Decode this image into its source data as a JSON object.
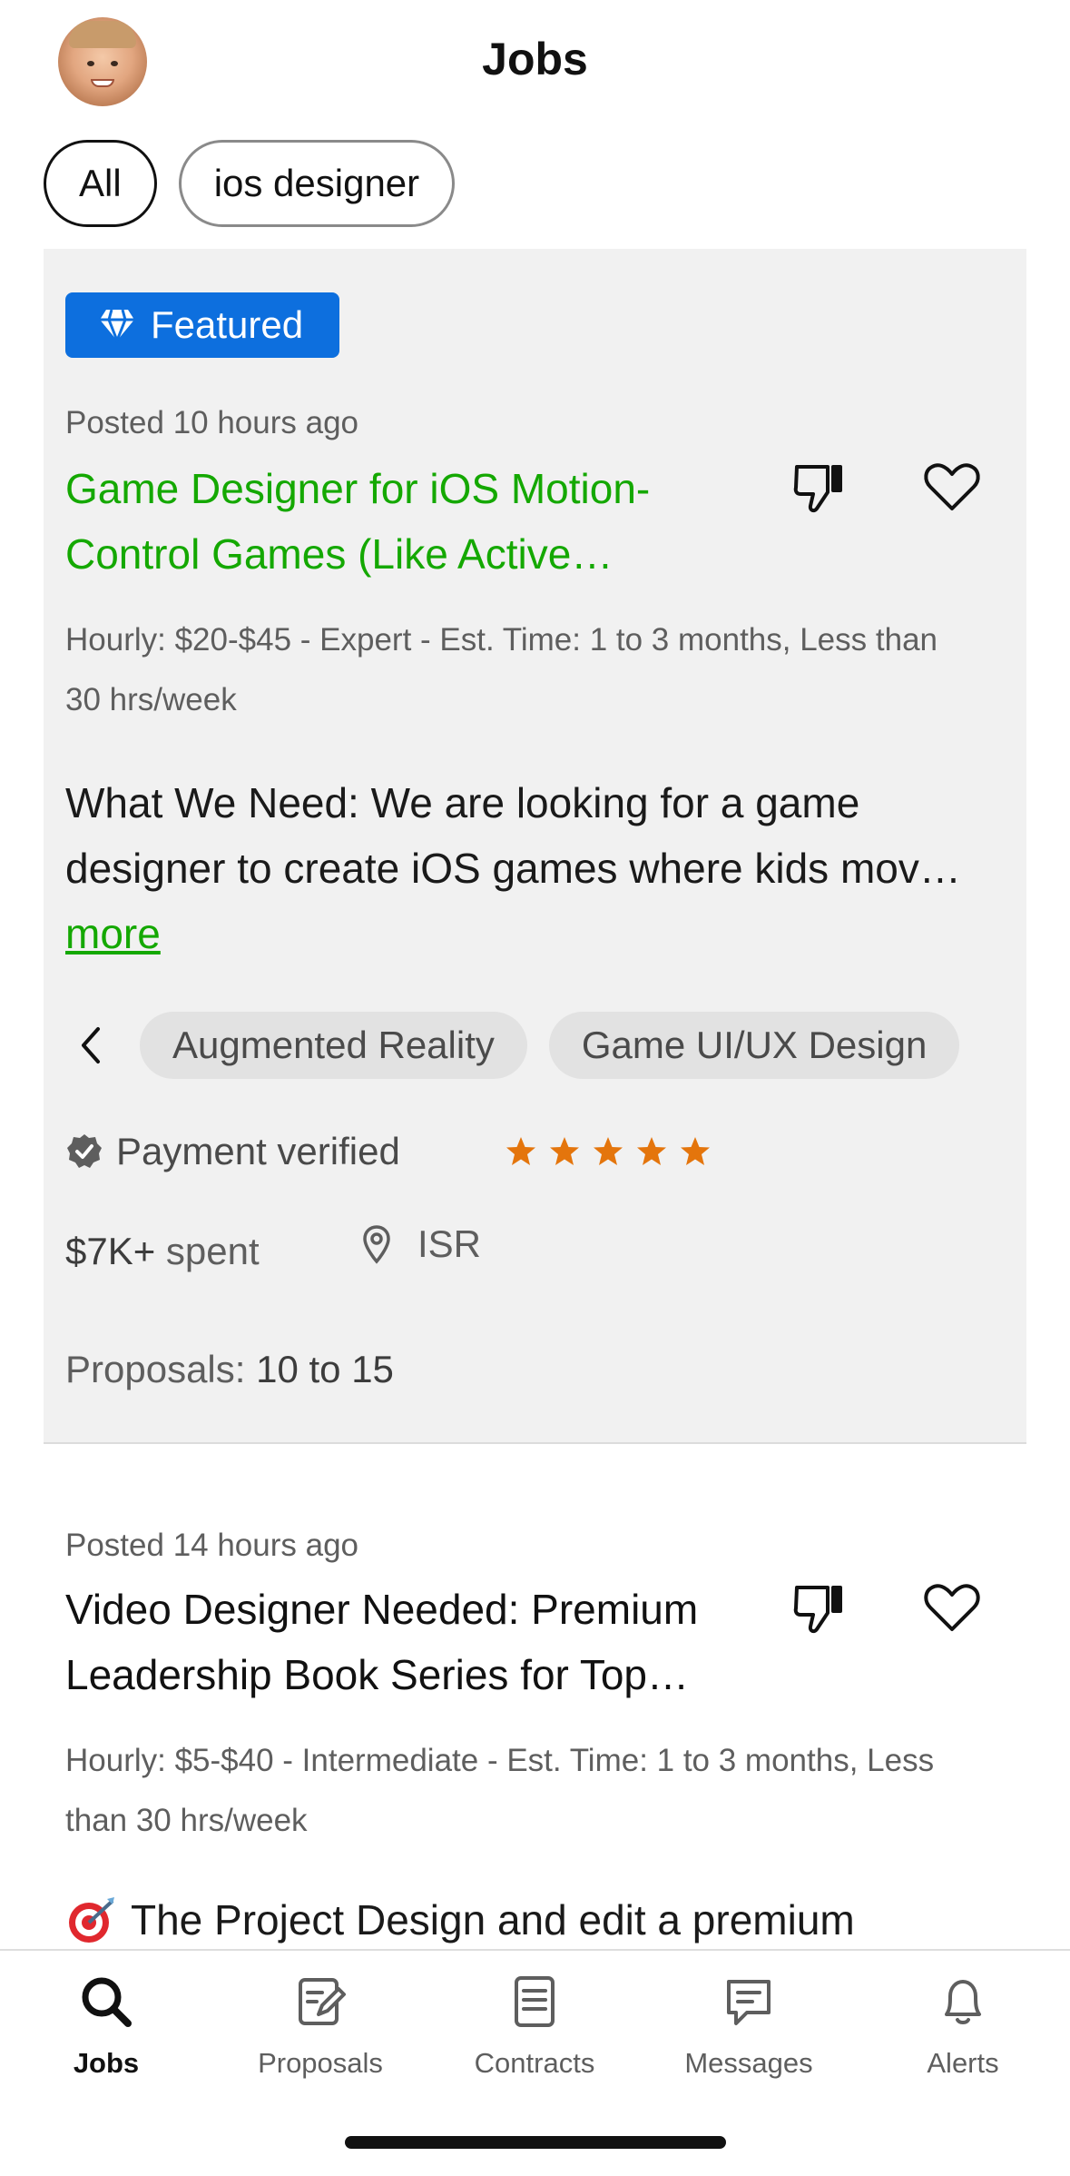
{
  "header": {
    "title": "Jobs"
  },
  "filters": {
    "chips": [
      {
        "label": "All"
      },
      {
        "label": "ios designer"
      }
    ]
  },
  "jobs": [
    {
      "featured_label": "Featured",
      "posted": "Posted 10 hours ago",
      "title_line1": "Game Designer for iOS Motion-",
      "title_line2": "Control Games (Like Active…",
      "meta_line1": "Hourly: $20-$45 - Expert - Est. Time: 1 to 3 months, Less than",
      "meta_line2": "30 hrs/week",
      "desc_line1": "What We Need: We are looking for a game",
      "desc_line2": "designer to create iOS games where kids mov…",
      "more_label": "more",
      "skills": [
        "Augmented Reality",
        "Game UI/UX Design"
      ],
      "payment_label": "Payment verified",
      "rating_stars": 5,
      "spent_amount": "$7K+",
      "spent_suffix": " spent",
      "location": "ISR",
      "proposals_label": "Proposals: ",
      "proposals_value": "10 to 15",
      "title_color": "#14a800"
    },
    {
      "posted": "Posted 14 hours ago",
      "title_line1": "Video Designer Needed: Premium",
      "title_line2": "Leadership Book Series for Top…",
      "meta_line1": "Hourly: $5-$40 - Intermediate - Est. Time: 1 to 3 months, Less",
      "meta_line2": "than 30 hrs/week",
      "desc_line1": "The Project Design and edit a premium"
    }
  ],
  "tabbar": {
    "tabs": [
      {
        "label": "Jobs",
        "icon": "search-icon",
        "active": true
      },
      {
        "label": "Proposals",
        "icon": "proposal-edit-icon"
      },
      {
        "label": "Contracts",
        "icon": "document-icon"
      },
      {
        "label": "Messages",
        "icon": "chat-bubble-icon"
      },
      {
        "label": "Alerts",
        "icon": "bell-icon"
      }
    ]
  },
  "colors": {
    "accent_green": "#14a800",
    "featured_blue": "#0d6fde",
    "star_orange": "#e4750c"
  }
}
